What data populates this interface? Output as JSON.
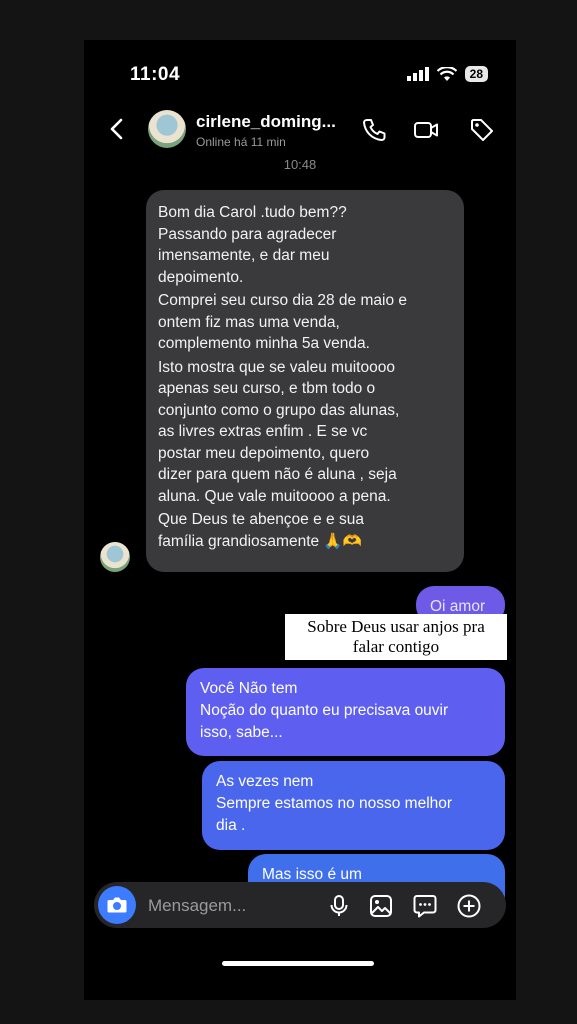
{
  "status": {
    "time": "11:04",
    "battery": "28"
  },
  "header": {
    "name": "cirlene_doming...",
    "presence": "Online há 11 min"
  },
  "thread": {
    "time_divider": "10:48",
    "incoming": [
      "Bom dia Carol .tudo bem??\nPassando para agradecer\nimensamente, e dar meu\ndepoimento.",
      "Comprei seu curso dia 28 de maio e\nontem fiz mas uma venda,\ncomplemento minha 5a venda.",
      "Isto mostra que se valeu muitoooo\napenas seu curso, e tbm todo o\nconjunto como o grupo das alunas,\nas livres extras enfim . E se vc\npostar meu depoimento, quero\ndizer para quem não é aluna , seja\naluna. Que vale muitoooo  a pena.",
      "Que Deus te abençoe e e sua\nfamília  grandiosamente 🙏🫶"
    ],
    "outgoing": [
      "Oi amor",
      "Você Não tem\nNoção do quanto eu precisava ouvir\nisso, sabe...",
      "As vezes nem\nSempre estamos no nosso melhor\ndia .",
      "Mas isso é um"
    ]
  },
  "caption": "Sobre Deus usar anjos pra\nfalar contigo",
  "composer": {
    "placeholder": "Mensagem..."
  },
  "icons": [
    "back-arrow-icon",
    "phone-icon",
    "video-camera-icon",
    "tag-icon",
    "camera-icon",
    "microphone-icon",
    "gallery-icon",
    "sticker-chat-icon",
    "plus-icon"
  ],
  "colors": {
    "accent": "#3d7bff",
    "bubble_in": "#3a3a3c",
    "bubble_out": "#5e5ff0"
  }
}
